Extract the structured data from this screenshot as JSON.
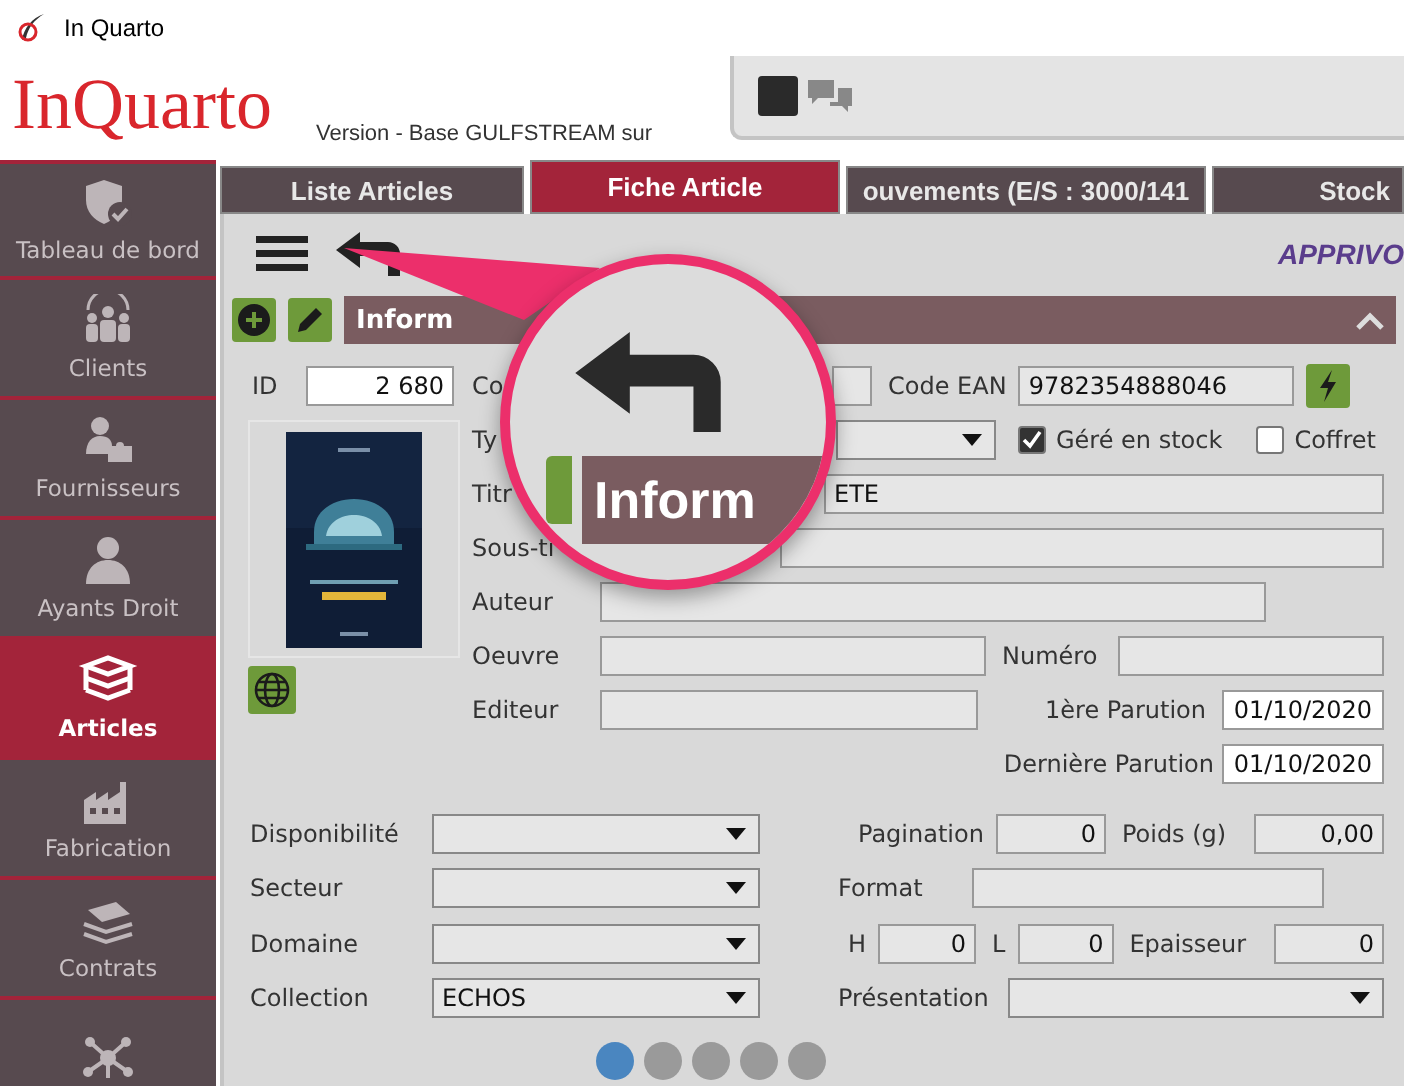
{
  "window": {
    "title": "In Quarto"
  },
  "header": {
    "logo": "InQuarto",
    "version": "Version  - Base GULFSTREAM sur"
  },
  "sidebar": {
    "items": [
      {
        "label": "Tableau de bord",
        "selected": false
      },
      {
        "label": "Clients",
        "selected": false
      },
      {
        "label": "Fournisseurs",
        "selected": false
      },
      {
        "label": "Ayants Droit",
        "selected": false
      },
      {
        "label": "Articles",
        "selected": true
      },
      {
        "label": "Fabrication",
        "selected": false
      },
      {
        "label": "Contrats",
        "selected": false
      },
      {
        "selected": false
      }
    ]
  },
  "tabs": [
    {
      "label": "Liste Articles",
      "selected": false
    },
    {
      "label": "Fiche Article",
      "selected": true
    },
    {
      "label": "ouvements (E/S : 3000/141",
      "selected": false
    },
    {
      "label": "Stock",
      "selected": false
    }
  ],
  "toolbar": {
    "title": "APPRIVO"
  },
  "section": {
    "title": "Inform"
  },
  "magnifier": {
    "title": "Inform"
  },
  "form": {
    "id": {
      "label": "ID",
      "value": "2 680"
    },
    "code": {
      "label": "Co"
    },
    "ean": {
      "label": "Code EAN",
      "value": "9782354888046"
    },
    "type": {
      "label": "Ty"
    },
    "checkboxes": [
      {
        "label": "Géré en stock",
        "checked": true
      },
      {
        "label": "Coffret",
        "checked": false
      }
    ],
    "titre": {
      "label": "Titr",
      "value": "ETE"
    },
    "sous_titre": {
      "label": "Sous-ti"
    },
    "auteur": {
      "label": "Auteur"
    },
    "oeuvre": {
      "label": "Oeuvre"
    },
    "numero": {
      "label": "Numéro"
    },
    "editeur": {
      "label": "Editeur"
    },
    "premiere_parution": {
      "label": "1ère Parution",
      "value": "01/10/2020"
    },
    "derniere_parution": {
      "label": "Dernière Parution",
      "value": "01/10/2020"
    },
    "disponibilite": {
      "label": "Disponibilité"
    },
    "pagination": {
      "label": "Pagination",
      "value": "0"
    },
    "poids": {
      "label": "Poids (g)",
      "value": "0,00"
    },
    "secteur": {
      "label": "Secteur"
    },
    "format": {
      "label": "Format"
    },
    "domaine": {
      "label": "Domaine"
    },
    "h": {
      "label": "H",
      "value": "0"
    },
    "l": {
      "label": "L",
      "value": "0"
    },
    "epaisseur": {
      "label": "Epaisseur",
      "value": "0"
    },
    "collection": {
      "label": "Collection",
      "value": "ECHOS"
    },
    "presentation": {
      "label": "Présentation"
    }
  },
  "pager": [
    {
      "selected": true
    },
    {
      "selected": false
    },
    {
      "selected": false
    },
    {
      "selected": false
    },
    {
      "selected": false
    }
  ]
}
